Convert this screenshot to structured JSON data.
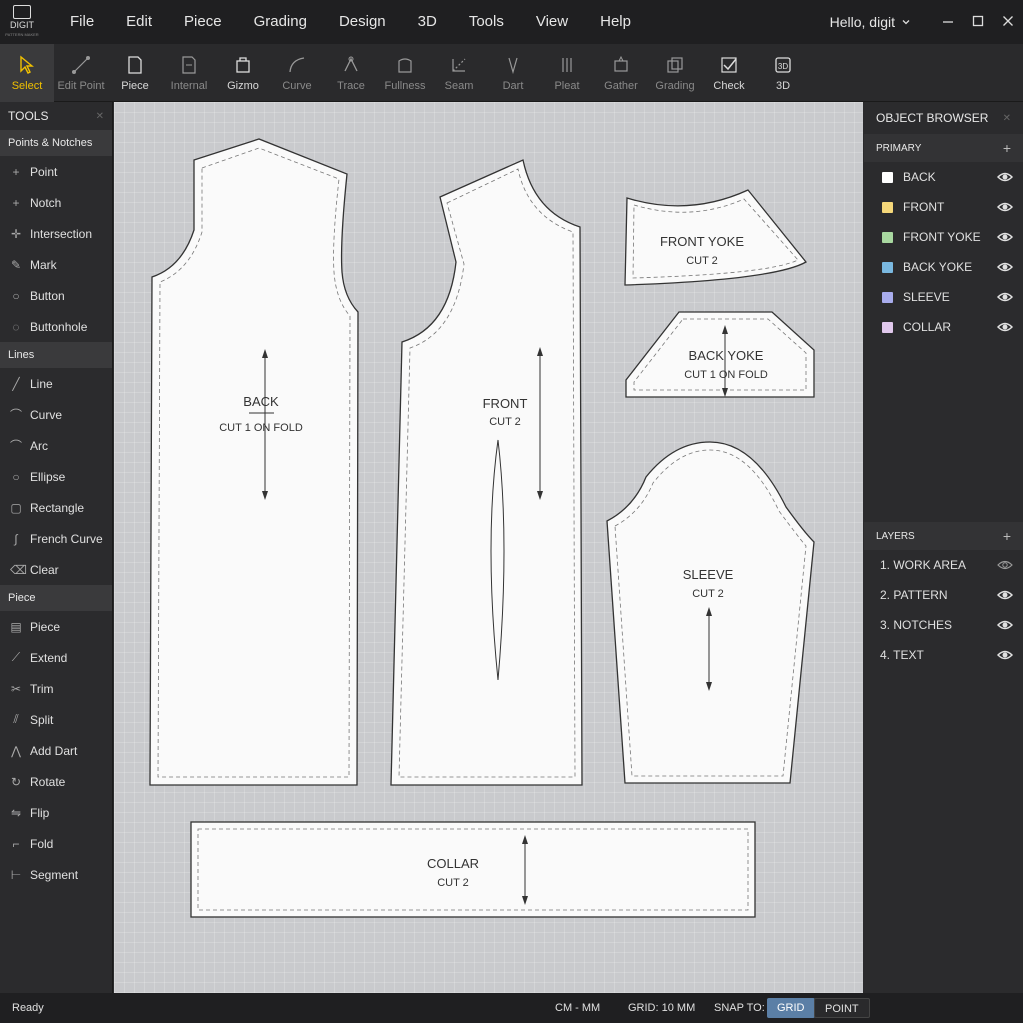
{
  "app": {
    "logo_text": "DIGIT",
    "logo_sub": "PATTERN MAKER",
    "user": "Hello, digit"
  },
  "menu": [
    "File",
    "Edit",
    "Piece",
    "Grading",
    "Design",
    "3D",
    "Tools",
    "View",
    "Help"
  ],
  "toolbar": [
    {
      "label": "Select",
      "icon": "cursor-icon"
    },
    {
      "label": "Edit Point",
      "icon": "edit-point-icon"
    },
    {
      "label": "Piece",
      "icon": "piece-icon"
    },
    {
      "label": "Internal",
      "icon": "internal-icon"
    },
    {
      "label": "Gizmo",
      "icon": "gizmo-icon"
    },
    {
      "label": "Curve",
      "icon": "curve-icon"
    },
    {
      "label": "Trace",
      "icon": "trace-icon"
    },
    {
      "label": "Fullness",
      "icon": "fullness-icon"
    },
    {
      "label": "Seam",
      "icon": "seam-icon"
    },
    {
      "label": "Dart",
      "icon": "dart-icon"
    },
    {
      "label": "Pleat",
      "icon": "pleat-icon"
    },
    {
      "label": "Gather",
      "icon": "gather-icon"
    },
    {
      "label": "Grading",
      "icon": "grading-icon"
    },
    {
      "label": "Check",
      "icon": "check-icon"
    },
    {
      "label": "3D",
      "icon": "cube-icon"
    }
  ],
  "tools_panel": {
    "title": "TOOLS",
    "sections": [
      {
        "title": "Points & Notches",
        "items": [
          "Point",
          "Notch",
          "Intersection",
          "Mark",
          "Button",
          "Buttonhole"
        ]
      },
      {
        "title": "Lines",
        "items": [
          "Line",
          "Curve",
          "Arc",
          "Ellipse",
          "Rectangle",
          "French Curve",
          "Clear"
        ]
      },
      {
        "title": "Piece",
        "items": [
          "Piece",
          "Extend",
          "Trim",
          "Split",
          "Add Dart",
          "Rotate",
          "Flip",
          "Fold",
          "Segment"
        ]
      }
    ]
  },
  "pieces": {
    "back": {
      "name": "BACK",
      "cut": "CUT 1 ON FOLD"
    },
    "front": {
      "name": "FRONT",
      "cut": "CUT 2"
    },
    "front_yoke": {
      "name": "FRONT YOKE",
      "cut": "CUT 2"
    },
    "back_yoke": {
      "name": "BACK YOKE",
      "cut": "CUT 1 ON FOLD"
    },
    "sleeve": {
      "name": "SLEEVE",
      "cut": "CUT 2"
    },
    "collar": {
      "name": "COLLAR",
      "cut": "CUT 2"
    }
  },
  "object_browser": {
    "title": "OBJECT BROWSER",
    "section": "PRIMARY",
    "items": [
      {
        "label": "BACK",
        "color": "#ffffff"
      },
      {
        "label": "FRONT",
        "color": "#f5d77a"
      },
      {
        "label": "FRONT YOKE",
        "color": "#a8d8a0"
      },
      {
        "label": "BACK YOKE",
        "color": "#7ab8e0"
      },
      {
        "label": "SLEEVE",
        "color": "#a8acec"
      },
      {
        "label": "COLLAR",
        "color": "#e0c8ec"
      }
    ]
  },
  "layers": {
    "title": "LAYERS",
    "items": [
      "1. WORK AREA",
      "2. PATTERN",
      "3. NOTCHES",
      "4. TEXT"
    ]
  },
  "status": {
    "state": "Ready",
    "units": "CM - MM",
    "grid": "GRID: 10 MM",
    "snap_label": "SNAP TO:",
    "snap_grid": "GRID",
    "snap_point": "POINT"
  }
}
